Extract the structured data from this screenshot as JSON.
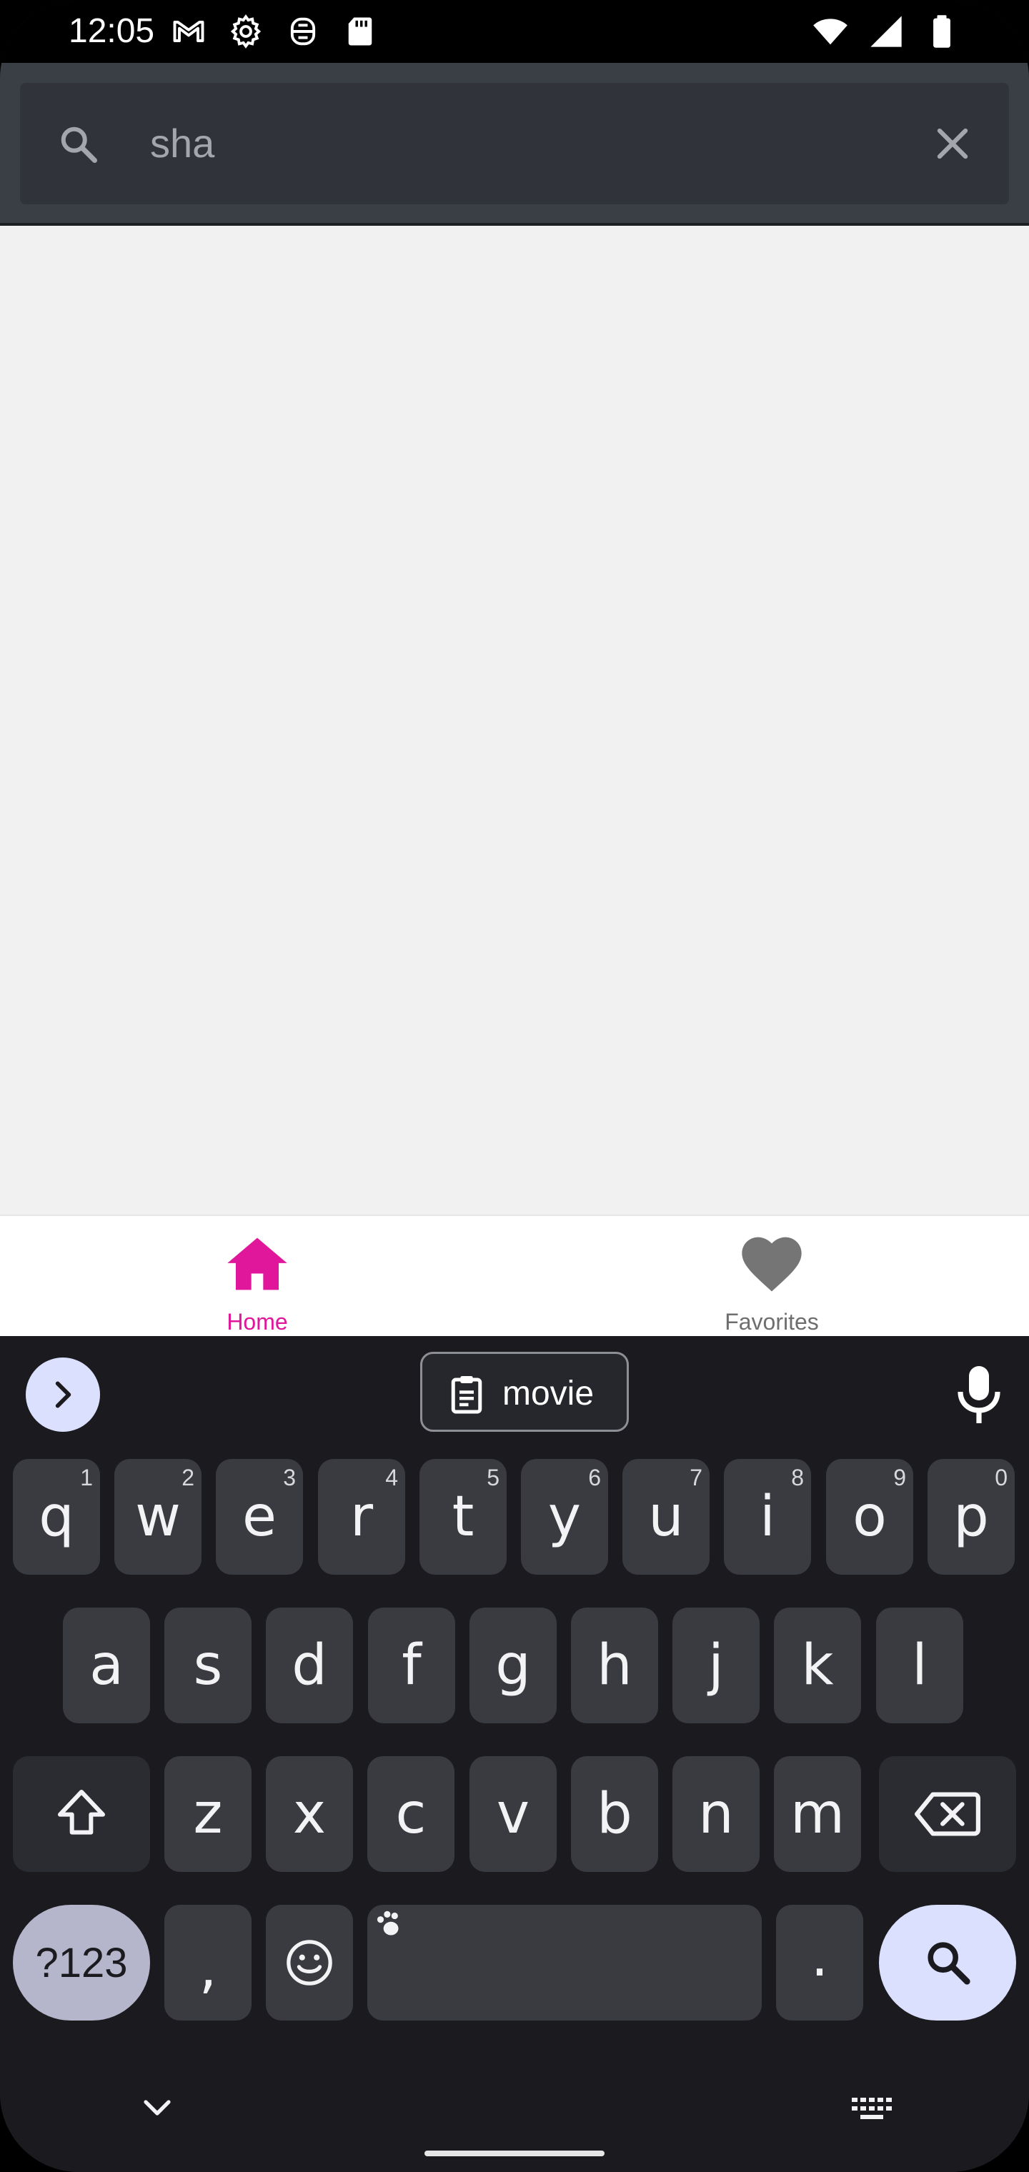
{
  "status_bar": {
    "time": "12:05",
    "left_icons": [
      "gmail-icon",
      "settings-gear-icon",
      "assistant-icon",
      "sd-card-icon"
    ],
    "right_icons": [
      "wifi-icon",
      "cellular-signal-icon",
      "battery-icon"
    ]
  },
  "search": {
    "query": "sha",
    "icon": "search-icon",
    "clear_icon": "close-icon"
  },
  "bottom_nav": {
    "items": [
      {
        "label": "Home",
        "icon": "home-icon",
        "active": true,
        "color": "#e0179a"
      },
      {
        "label": "Favorites",
        "icon": "heart-icon",
        "active": false,
        "color": "#6e6e6e"
      }
    ]
  },
  "keyboard": {
    "suggestion_chip": "movie",
    "rows": [
      [
        {
          "ch": "q",
          "hint": "1"
        },
        {
          "ch": "w",
          "hint": "2"
        },
        {
          "ch": "e",
          "hint": "3"
        },
        {
          "ch": "r",
          "hint": "4"
        },
        {
          "ch": "t",
          "hint": "5"
        },
        {
          "ch": "y",
          "hint": "6"
        },
        {
          "ch": "u",
          "hint": "7"
        },
        {
          "ch": "i",
          "hint": "8"
        },
        {
          "ch": "o",
          "hint": "9"
        },
        {
          "ch": "p",
          "hint": "0"
        }
      ],
      [
        "a",
        "s",
        "d",
        "f",
        "g",
        "h",
        "j",
        "k",
        "l"
      ],
      [
        "z",
        "x",
        "c",
        "v",
        "b",
        "n",
        "m"
      ]
    ],
    "symbols_label": "?123",
    "comma": ",",
    "period": ".",
    "accent_color": "#dce0ff"
  }
}
